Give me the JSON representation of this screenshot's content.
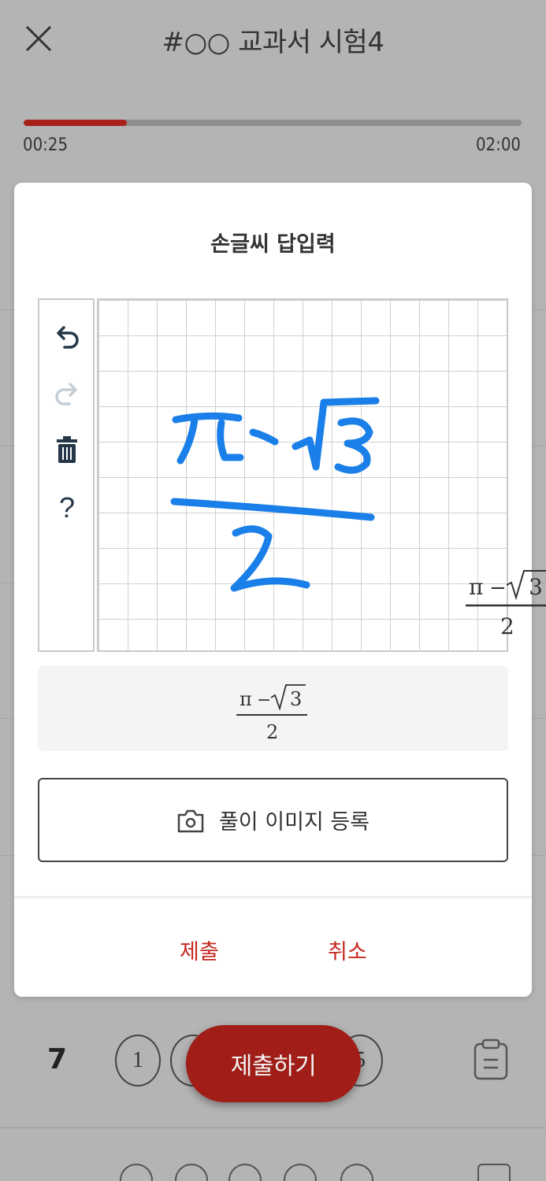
{
  "header": {
    "title": "#○○ 교과서 시험4",
    "progress_fraction": 0.208,
    "time_elapsed": "00:25",
    "time_total": "02:00",
    "progress_color": "#a8201a"
  },
  "modal": {
    "title": "손글씨 답입력",
    "tools": {
      "undo": "undo-arrow-icon",
      "redo": "redo-arrow-icon",
      "clear": "trash-icon",
      "help_label": "?"
    },
    "ink_color": "#1a7fe8",
    "recognized": {
      "numerator_pi": "π",
      "numerator_minus": "−",
      "numerator_radicand": "3",
      "denominator": "2"
    },
    "upload_label": "풀이 이미지 등록",
    "submit_label": "제출",
    "cancel_label": "취소",
    "accent_color": "#c4281f"
  },
  "background_row": {
    "number": "7",
    "choices": [
      "1",
      "",
      "5"
    ],
    "fab_label": "제출하기",
    "fab_color": "#a01e17"
  }
}
